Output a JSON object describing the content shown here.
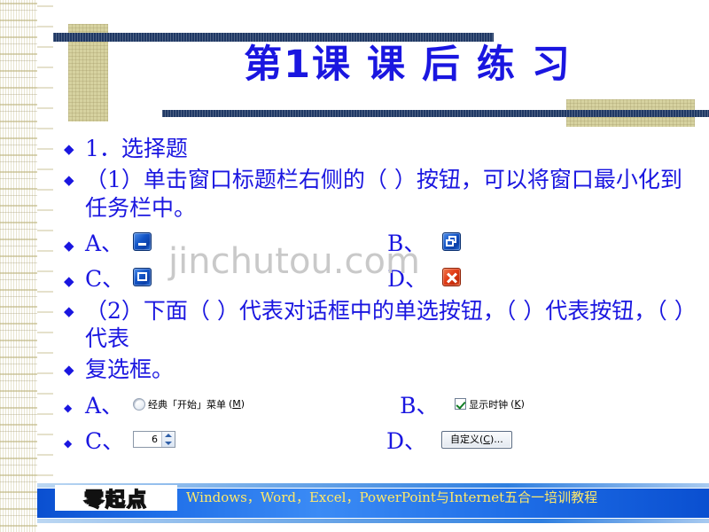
{
  "slide": {
    "title": "第1课 课 后 练 习",
    "watermark": "jinchutou.com",
    "bullet_glyph": "◆",
    "colors": {
      "title_blue": "#1a16e0",
      "body_blue": "#1a16e0",
      "deco_navy": "#1f3864",
      "deco_tan": "#d6d2a0",
      "footer_blue": "#1f6fe8",
      "footer_yellow": "#ffe96a",
      "close_red": "#e23c16",
      "button_blue": "#1456c8"
    }
  },
  "body": {
    "line1": "1．选择题",
    "line2": "（1）单击窗口标题栏右侧的（    ）按钮，可以将窗口最小化到任务栏中。",
    "line3": "（2）下面（    ）代表对话框中的单选按钮，（    ）代表按钮，（    ）代表",
    "line4": "复选框。"
  },
  "question1_options": [
    {
      "label": "A、",
      "icon": "window-minimize-icon"
    },
    {
      "label": "B、",
      "icon": "window-restore-icon"
    },
    {
      "label": "C、",
      "icon": "window-maximize-icon"
    },
    {
      "label": "D、",
      "icon": "window-close-icon"
    }
  ],
  "question2_options": [
    {
      "label": "A、",
      "widget": "radio-button",
      "text": "经典「开始」菜单",
      "mnemonic": "M"
    },
    {
      "label": "B、",
      "widget": "checkbox-checked",
      "text": "显示时钟",
      "mnemonic": "K"
    },
    {
      "label": "C、",
      "widget": "number-spinner",
      "value": "6"
    },
    {
      "label": "D、",
      "widget": "push-button",
      "text": "自定义",
      "mnemonic": "C",
      "suffix": "..."
    }
  ],
  "footer": {
    "logo_text": "零起点",
    "tagline": "Windows，Word，Excel，PowerPoint与Internet五合一培训教程"
  }
}
